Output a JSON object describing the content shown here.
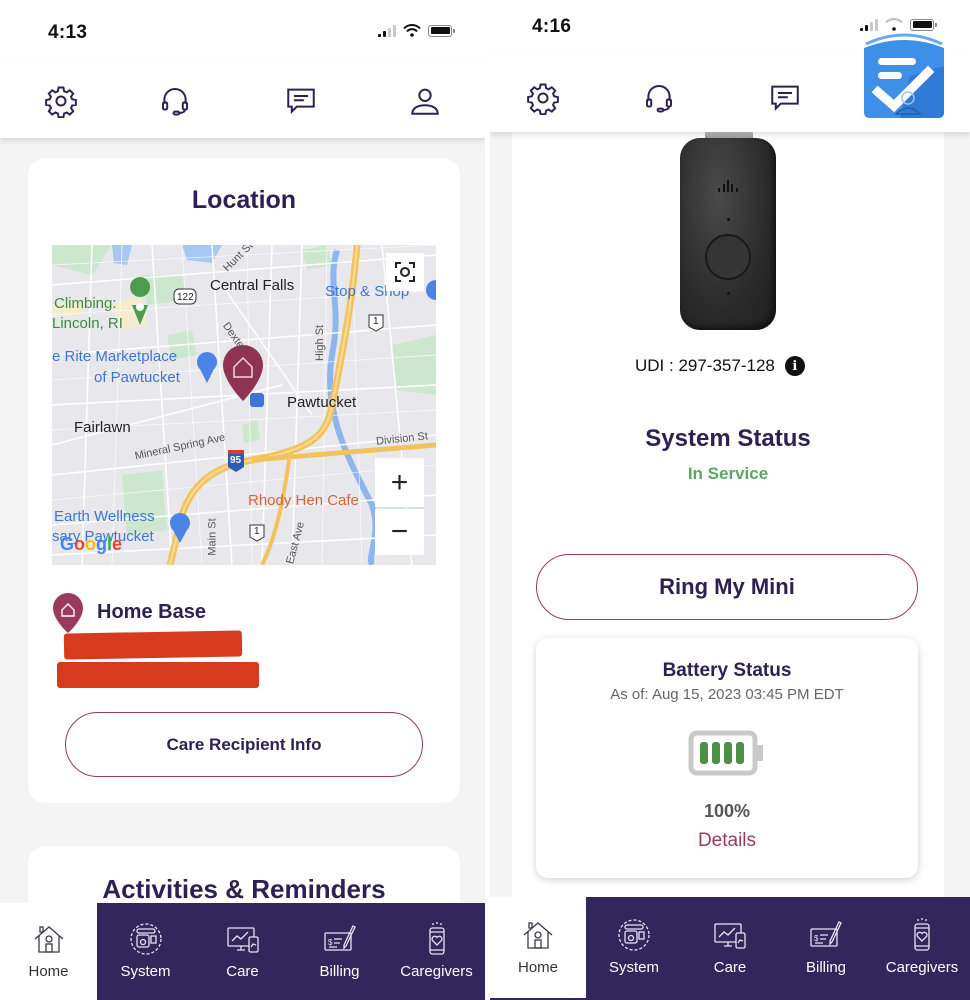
{
  "left_screen": {
    "status_bar": {
      "time": "4:13"
    },
    "top_nav": [
      "settings",
      "support",
      "messages",
      "profile"
    ],
    "location_card": {
      "title": "Location",
      "map": {
        "labels": {
          "central_falls": "Central Falls",
          "stop_shop": "Stop & Shop",
          "climbing_1": "Climbing:",
          "climbing_2": "Lincoln, RI",
          "rite_1": "e Rite Marketplace",
          "rite_2": "of Pawtucket",
          "pawtucket": "Pawtucket",
          "fairlawn": "Fairlawn",
          "mineral": "Mineral Spring Ave",
          "division": "Division St",
          "high_st": "High St",
          "main_st": "Main St",
          "east_ave": "East Ave",
          "hunt": "Hunt St",
          "dexter": "Dexter",
          "rhody": "Rhody Hen Cafe",
          "earth_1": "Earth Wellness",
          "earth_2": "sary Pawtucket",
          "route_122": "122",
          "route_1": "1",
          "route_95": "95",
          "google": "Google"
        },
        "zoom_in": "+",
        "zoom_out": "−"
      },
      "home_base_label": "Home Base",
      "care_recipient_button": "Care Recipient Info"
    },
    "activities_card": {
      "title": "Activities & Reminders"
    }
  },
  "right_screen": {
    "status_bar": {
      "time": "4:16"
    },
    "udi_label": "UDI : 297-357-128",
    "system_status": {
      "title": "System Status",
      "value": "In Service"
    },
    "ring_button": "Ring My Mini",
    "battery": {
      "title": "Battery Status",
      "as_of": "As of: Aug 15, 2023 03:45 PM EDT",
      "percent_label": "100%",
      "level": 1.0,
      "details_link": "Details"
    }
  },
  "bottom_tabs": [
    {
      "label": "Home",
      "active": true
    },
    {
      "label": "System",
      "active": false
    },
    {
      "label": "Care",
      "active": false
    },
    {
      "label": "Billing",
      "active": false
    },
    {
      "label": "Caregivers",
      "active": false
    }
  ],
  "colors": {
    "primary_purple": "#2e2055",
    "tab_bar_purple": "#33265c",
    "accent_maroon": "#9a3a5c",
    "status_green": "#5aa864",
    "battery_green": "#4c8f47",
    "redaction_red": "#d63b1f",
    "overlay_blue": "#3d8fe8"
  }
}
